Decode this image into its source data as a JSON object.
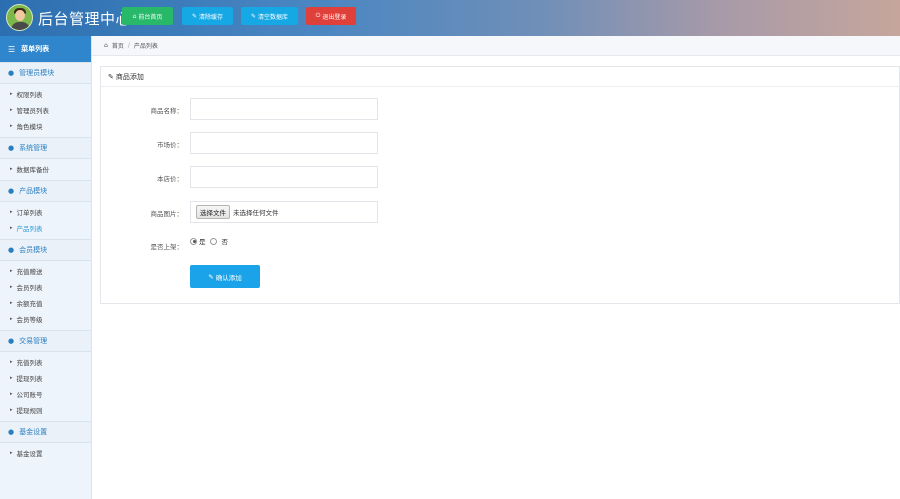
{
  "header": {
    "title": "后台管理中心",
    "buttons": [
      {
        "label": "前台首页",
        "icon": "home-icon"
      },
      {
        "label": "清除缓存",
        "icon": "wrench-icon"
      },
      {
        "label": "清空数据库",
        "icon": "wrench-icon"
      },
      {
        "label": "退出登录",
        "icon": "power-icon"
      }
    ]
  },
  "sidebar": {
    "menu_title": "菜单列表",
    "groups": [
      {
        "title": "管理员模块",
        "items": [
          "权限列表",
          "管理员列表",
          "角色模块"
        ]
      },
      {
        "title": "系统管理",
        "items": [
          "数据库备份"
        ]
      },
      {
        "title": "产品模块",
        "items": [
          "订单列表",
          "产品列表"
        ]
      },
      {
        "title": "会员模块",
        "items": [
          "充值赠送",
          "会员列表",
          "余额充值",
          "会员等级"
        ]
      },
      {
        "title": "交易管理",
        "items": [
          "充值列表",
          "提现列表",
          "公司账号",
          "提现规则"
        ]
      },
      {
        "title": "基金设置",
        "items": [
          "基金设置"
        ]
      }
    ],
    "active_item": "产品列表"
  },
  "breadcrumb": {
    "home": "首页",
    "current": "产品列表"
  },
  "form": {
    "panel_title": "商品添加",
    "name_label": "商品名称：",
    "market_price_label": "市场价：",
    "shop_price_label": "本店价：",
    "image_label": "商品图片：",
    "file_button": "选择文件",
    "file_status": "未选择任何文件",
    "onsale_label": "是否上架：",
    "yes": "是",
    "no": "否",
    "submit": "确认添加"
  }
}
